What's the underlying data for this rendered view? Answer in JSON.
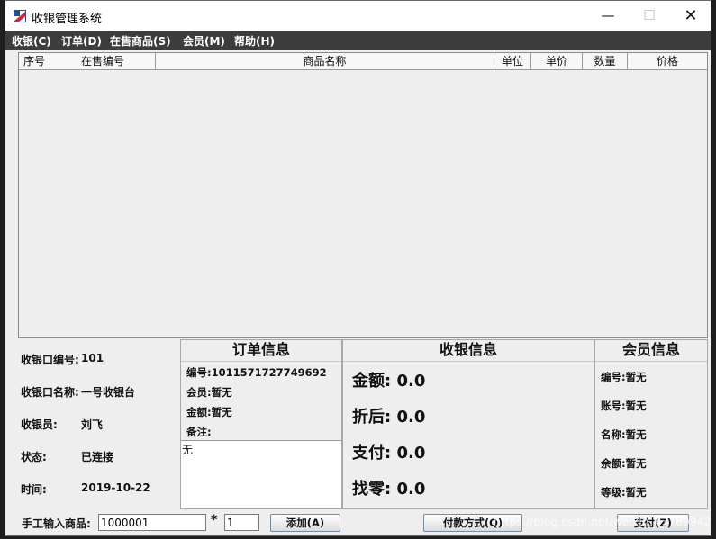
{
  "window": {
    "title": "收银管理系统"
  },
  "menu": [
    {
      "label": "收银(C)"
    },
    {
      "label": "订单(D)"
    },
    {
      "label": "在售商品(S)"
    },
    {
      "label": "会员(M)"
    },
    {
      "label": "帮助(H)"
    }
  ],
  "table": {
    "columns": [
      "序号",
      "在售编号",
      "商品名称",
      "单位",
      "单价",
      "数量",
      "价格"
    ]
  },
  "register": {
    "items": [
      {
        "label": "收银口编号:",
        "value": "101"
      },
      {
        "label": "收银口名称:",
        "value": "一号收银台"
      },
      {
        "label": "收银员:",
        "value": "刘飞"
      },
      {
        "label": "状态:",
        "value": "已连接"
      },
      {
        "label": "时间:",
        "value": "2019-10-22"
      }
    ]
  },
  "order": {
    "title": "订单信息",
    "lines": [
      "编号:1011571727749692",
      "会员:暂无",
      "金额:暂无",
      "备注:"
    ],
    "note": "无"
  },
  "cashier": {
    "title": "收银信息",
    "lines": [
      "金额: 0.0",
      "折后: 0.0",
      "支付: 0.0",
      "找零: 0.0"
    ]
  },
  "member": {
    "title": "会员信息",
    "lines": [
      "编号:暂无",
      "账号:暂无",
      "名称:暂无",
      "余额:暂无",
      "等级:暂无"
    ]
  },
  "bottom": {
    "manual_label": "手工输入商品:",
    "product_code": "1000001",
    "times": "*",
    "quantity": "1",
    "add_label": "添加(A)",
    "payment_method_label": "付款方式(Q)",
    "pay_label": "支付(Z)"
  },
  "watermark": "https://blog.csdn.net/weixin_43789942",
  "icons": {
    "minimize": "minimize-icon",
    "maximize": "maximize-icon",
    "close": "close-icon",
    "app": "app-logo-icon"
  }
}
